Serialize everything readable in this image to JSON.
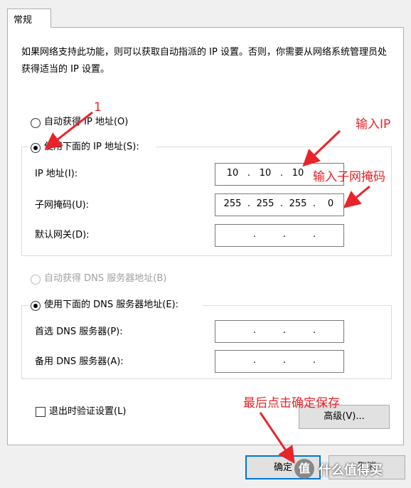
{
  "tab": {
    "label": "常规"
  },
  "description": "如果网络支持此功能，则可以获取自动指派的 IP 设置。否则，你需要从网络系统管理员处获得适当的 IP 设置。",
  "ip": {
    "auto_label": "自动获得 IP 地址(O)",
    "manual_label": "使用下面的 IP 地址(S):",
    "address_label": "IP 地址(I):",
    "address": [
      "10",
      "10",
      "10",
      ""
    ],
    "mask_label": "子网掩码(U):",
    "mask": [
      "255",
      "255",
      "255",
      "0"
    ],
    "gateway_label": "默认网关(D):",
    "gateway": [
      "",
      "",
      "",
      ""
    ]
  },
  "dns": {
    "auto_label": "自动获得 DNS 服务器地址(B)",
    "manual_label": "使用下面的 DNS 服务器地址(E):",
    "preferred_label": "首选 DNS 服务器(P):",
    "preferred": [
      "",
      "",
      "",
      ""
    ],
    "alternate_label": "备用 DNS 服务器(A):",
    "alternate": [
      "",
      "",
      "",
      ""
    ]
  },
  "validate_label": "退出时验证设置(L)",
  "advanced_label": "高级(V)...",
  "ok_label": "确定",
  "cancel_label": "取消",
  "annotations": {
    "step1": "1",
    "input_ip": "输入IP",
    "input_mask": "输入子网掩码",
    "save": "最后点击确定保存"
  },
  "watermark": {
    "badge": "值",
    "text": "什么值得买"
  },
  "colors": {
    "annotation": "#e8242a",
    "panel_bg": "#ffffff",
    "window_bg": "#f0f0f0"
  }
}
